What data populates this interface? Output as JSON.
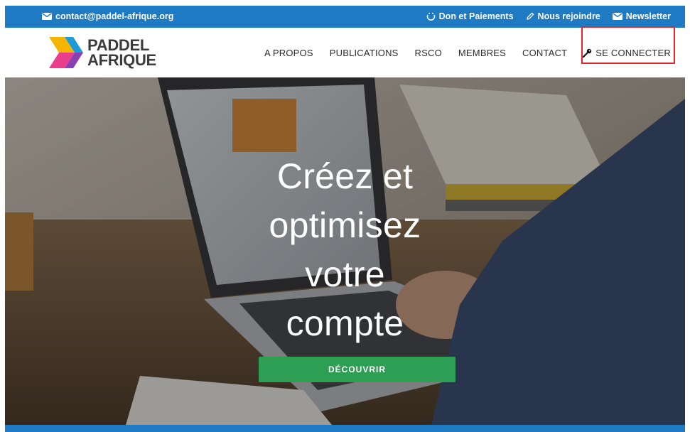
{
  "topbar": {
    "email": "contact@paddel-afrique.org",
    "links": [
      {
        "label": "Don et Paiements",
        "icon": "donation-icon"
      },
      {
        "label": "Nous rejoindre",
        "icon": "pencil-icon"
      },
      {
        "label": "Newsletter",
        "icon": "envelope-icon"
      }
    ]
  },
  "logo": {
    "line1": "PADDEL",
    "line2": "AFRIQUE"
  },
  "nav": {
    "items": [
      "A PROPOS",
      "PUBLICATIONS",
      "RSCO",
      "MEMBRES",
      "CONTACT"
    ],
    "login": "SE CONNECTER"
  },
  "hero": {
    "lines": [
      "Créez et",
      "optimisez",
      "votre",
      "compte"
    ],
    "cta": "DÉCOUVRIR"
  },
  "colors": {
    "brand_blue": "#1e7ac2",
    "cta_green": "#2e9e54",
    "highlight_red": "#e0262b"
  }
}
